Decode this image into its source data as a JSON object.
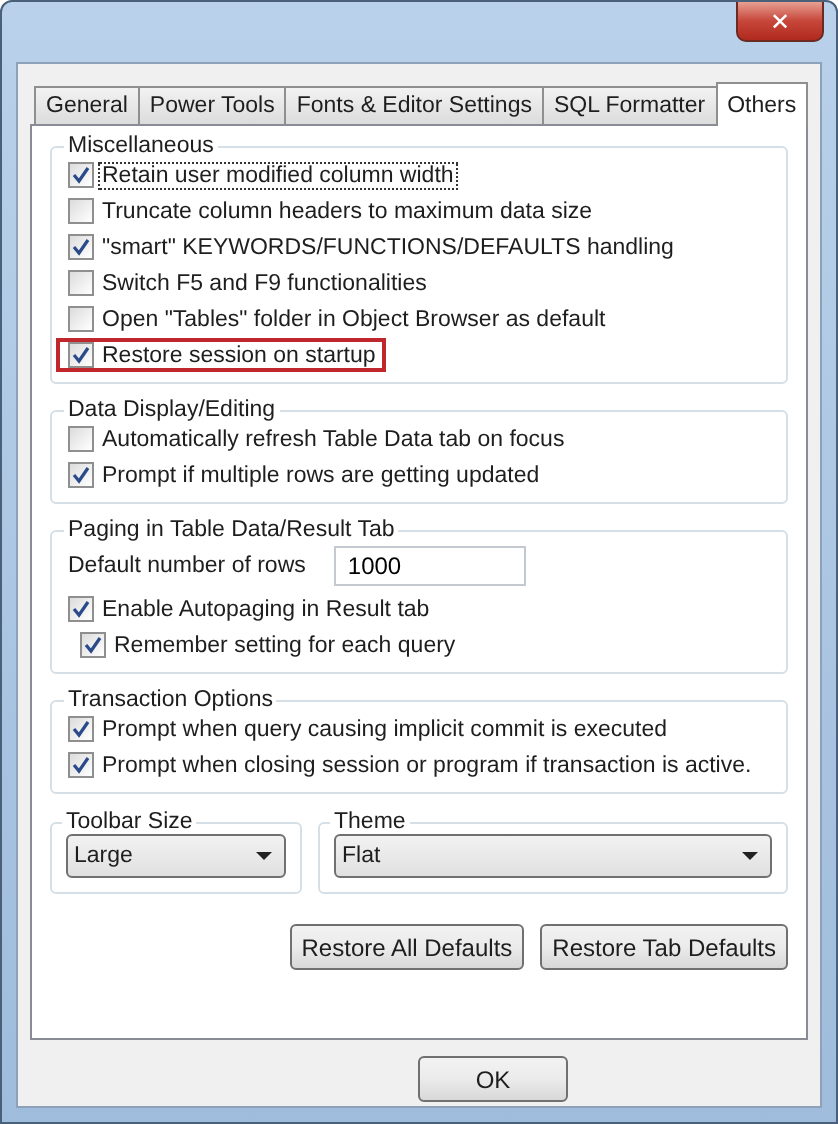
{
  "window": {
    "close_label": "✕"
  },
  "tabs": [
    {
      "label": "General",
      "selected": false
    },
    {
      "label": "Power Tools",
      "selected": false
    },
    {
      "label": "Fonts & Editor Settings",
      "selected": false
    },
    {
      "label": "SQL Formatter",
      "selected": false
    },
    {
      "label": "Others",
      "selected": true
    }
  ],
  "groups": [
    {
      "title": "Miscellaneous",
      "items": [
        {
          "kind": "checkbox",
          "label": "Retain user modified column width",
          "checked": true,
          "focused": true,
          "highlighted": false
        },
        {
          "kind": "checkbox",
          "label": "Truncate column headers to maximum data size",
          "checked": false,
          "focused": false,
          "highlighted": false
        },
        {
          "kind": "checkbox",
          "label": "\"smart\" KEYWORDS/FUNCTIONS/DEFAULTS handling",
          "checked": true,
          "focused": false,
          "highlighted": false
        },
        {
          "kind": "checkbox",
          "label": "Switch F5 and F9 functionalities",
          "checked": false,
          "focused": false,
          "highlighted": false
        },
        {
          "kind": "checkbox",
          "label": "Open \"Tables\" folder in Object Browser as default",
          "checked": false,
          "focused": false,
          "highlighted": false
        },
        {
          "kind": "checkbox",
          "label": "Restore session on startup",
          "checked": true,
          "focused": false,
          "highlighted": true
        }
      ]
    },
    {
      "title": "Data Display/Editing",
      "items": [
        {
          "kind": "checkbox",
          "label": "Automatically refresh Table Data tab on focus",
          "checked": false,
          "focused": false,
          "highlighted": false
        },
        {
          "kind": "checkbox",
          "label": "Prompt if multiple rows are getting updated",
          "checked": true,
          "focused": false,
          "highlighted": false
        }
      ]
    },
    {
      "title": "Paging in Table Data/Result Tab",
      "items": [
        {
          "kind": "field",
          "label": "Default number of rows",
          "value": "1000"
        },
        {
          "kind": "checkbox",
          "label": "Enable Autopaging in Result tab",
          "checked": true,
          "focused": false,
          "highlighted": false
        },
        {
          "kind": "subcheckbox",
          "label": "Remember setting for each query",
          "checked": true,
          "focused": false,
          "highlighted": false
        }
      ]
    },
    {
      "title": "Transaction Options",
      "items": [
        {
          "kind": "checkbox",
          "label": "Prompt when query causing implicit commit is executed",
          "checked": true,
          "focused": false,
          "highlighted": false
        },
        {
          "kind": "checkbox",
          "label": "Prompt when closing session or program if transaction is active.",
          "checked": true,
          "focused": false,
          "highlighted": false
        }
      ]
    }
  ],
  "selects": [
    {
      "title": "Toolbar Size",
      "value": "Large"
    },
    {
      "title": "Theme",
      "value": "Flat"
    }
  ],
  "panel_buttons": [
    "Restore All Defaults",
    "Restore Tab Defaults"
  ],
  "dialog_buttons": [
    "OK"
  ]
}
